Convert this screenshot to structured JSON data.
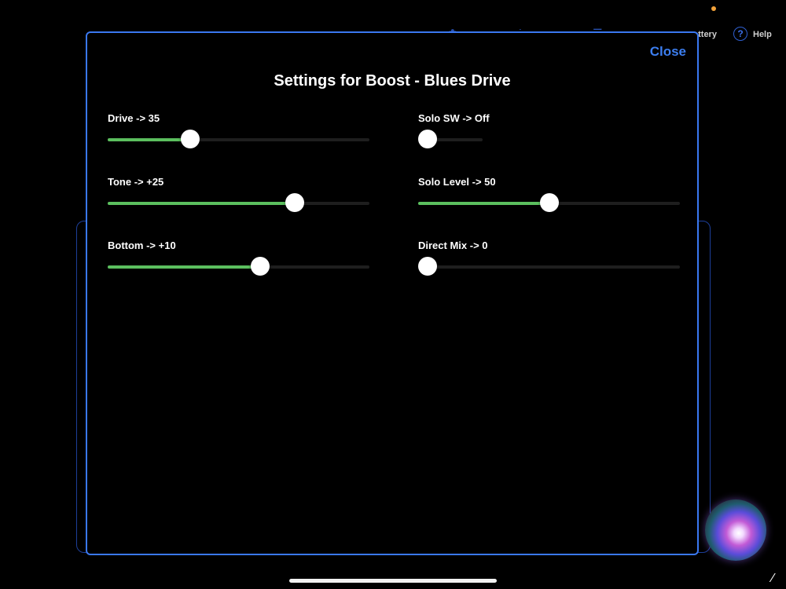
{
  "background": {
    "toolbar_items": [
      {
        "icon": "gear-icon",
        "label": ""
      },
      {
        "icon": "mixer-icon",
        "label": ""
      },
      {
        "icon": "stack-icon",
        "label": ""
      },
      {
        "icon": "battery-icon",
        "label": "attery"
      },
      {
        "icon": "help-icon",
        "label": "Help"
      }
    ],
    "help_glyph": "?"
  },
  "modal": {
    "title": "Settings for Boost - Blues Drive",
    "close_label": "Close",
    "accent_color": "#3a78f0",
    "params": [
      {
        "label": "Drive -> 35",
        "value": 0.3
      },
      {
        "label": "Solo SW -> Off",
        "value": 0.0
      },
      {
        "label": "Tone -> +25",
        "value": 0.73
      },
      {
        "label": "Solo Level -> 50",
        "value": 0.5
      },
      {
        "label": "Bottom -> +10",
        "value": 0.59
      },
      {
        "label": "Direct Mix -> 0",
        "value": 0.0
      }
    ],
    "fill_color": "#5bbf5e"
  }
}
